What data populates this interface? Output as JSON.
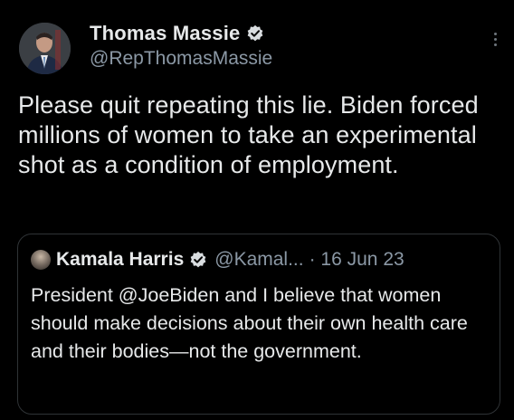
{
  "tweet": {
    "author": {
      "display_name": "Thomas Massie",
      "handle": "@RepThomasMassie",
      "verified": true,
      "avatar": "person-photo"
    },
    "text": "Please quit repeating this lie. Biden forced millions of women to take an experimental shot as a condition of employment.",
    "more_icon": "more-vertical-icon"
  },
  "quoted_tweet": {
    "author": {
      "display_name": "Kamala Harris",
      "handle": "@Kamal...",
      "verified": true,
      "avatar": "person-photo"
    },
    "date": "· 16 Jun 23",
    "text": "President @JoeBiden and I believe that women should make decisions about their own health care and their bodies—not the government."
  },
  "colors": {
    "background": "#000000",
    "text": "#e7e9ea",
    "secondary": "#8b98a5",
    "verified_badge": "#d9dde0",
    "border": "#2f3336"
  }
}
